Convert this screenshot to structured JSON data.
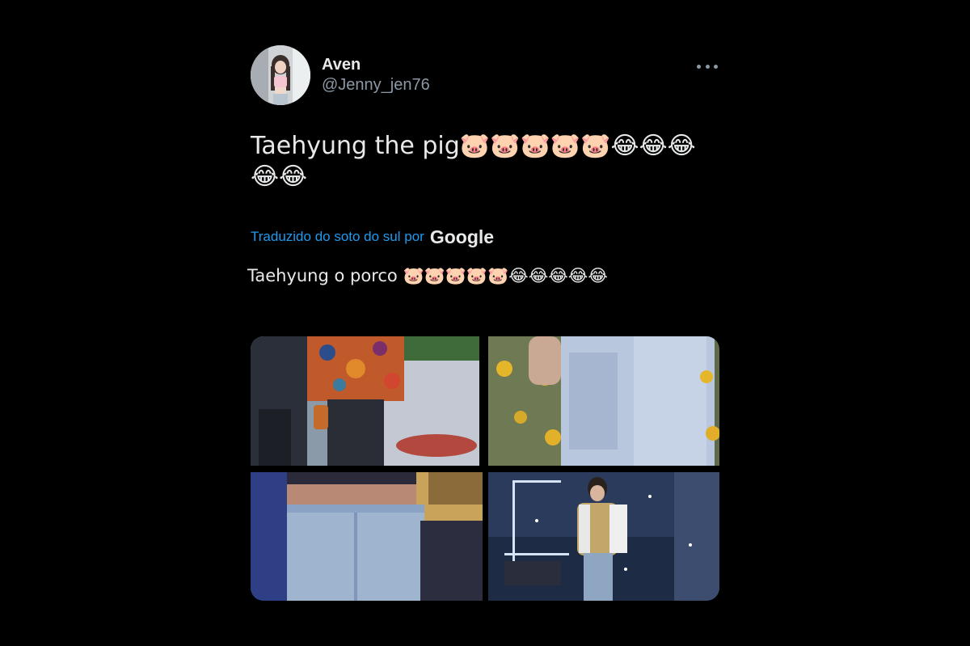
{
  "user": {
    "display_name": "Aven",
    "handle": "@Jenny_jen76",
    "avatar_icon": "profile-photo"
  },
  "tweet": {
    "text": "Taehyung the pig🐷🐷🐷🐷🐷😂😂😂😂😂",
    "translation_label": "Traduzido do soto do sul por",
    "translation_provider": "Google",
    "translated_text": "Taehyung o porco 🐷🐷🐷🐷🐷😂😂😂😂😂"
  },
  "menu": {
    "more_icon": "more-horizontal-icon"
  },
  "media": {
    "count": 4,
    "items": [
      {
        "icon": "photo-floral-shirt"
      },
      {
        "icon": "photo-light-blue-shirt-flowers"
      },
      {
        "icon": "photo-jeans-waist"
      },
      {
        "icon": "photo-stage-performance"
      }
    ]
  },
  "colors": {
    "background": "#000000",
    "primary_text": "#e7e9ea",
    "secondary_text": "#8b98a5",
    "link": "#1d9bf0"
  }
}
